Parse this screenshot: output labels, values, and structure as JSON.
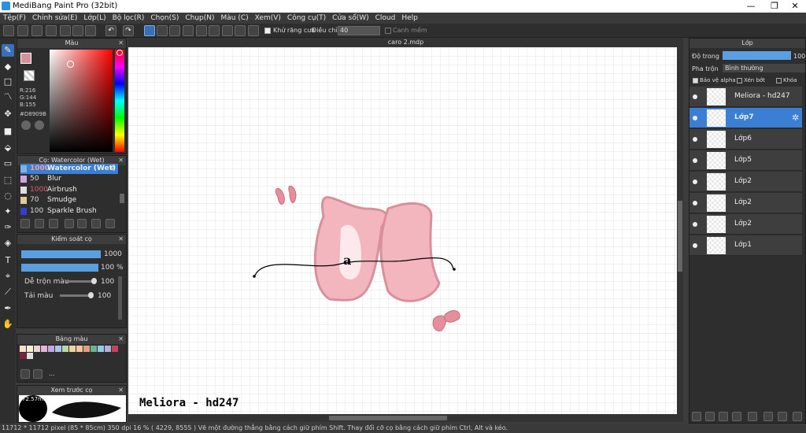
{
  "window": {
    "title": "MediBang Paint Pro (32bit)"
  },
  "menu": [
    "Tệp(F)",
    "Chỉnh sửa(E)",
    "Lớp(L)",
    "Bộ lọc(R)",
    "Chọn(S)",
    "Chụp(N)",
    "Màu (C)",
    "Xem(V)",
    "Công cụ(T)",
    "Cửa sổ(W)",
    "Cloud",
    "Help"
  ],
  "toolbar": {
    "antialias_label": "Khử răng cưa",
    "adjust_label": "Điều chỉnh",
    "adjust_value": "40",
    "smooth_label": "Canh mềm"
  },
  "color_panel": {
    "title": "Màu",
    "r": "R:216",
    "g": "G:144",
    "b": "B:155",
    "hex": "#D8909B",
    "current_color": "#D8909B"
  },
  "brush_panel": {
    "title": "Cọ: Watercolor (Wet)",
    "items": [
      {
        "size": "1000",
        "name": "Watercolor (Wet)",
        "color": "#7fb3e8"
      },
      {
        "size": "50",
        "name": "Blur",
        "color": "#d8a0e0"
      },
      {
        "size": "1000",
        "name": "Airbrush",
        "color": "#e0e0e0"
      },
      {
        "size": "70",
        "name": "Smudge",
        "color": "#e6c89c"
      },
      {
        "size": "100",
        "name": "Sparkle Brush",
        "color": "#3040d0"
      }
    ]
  },
  "brush_control": {
    "title": "Kiểm soát cọ",
    "size_value": "1000",
    "opacity_value": "100 %",
    "mix_label": "Dễ trộn màu",
    "mix_value": "100",
    "load_label": "Tải màu",
    "load_value": "100",
    "size_fill": 1.0,
    "opacity_fill": 1.0
  },
  "palette_panel": {
    "title": "Bảng màu",
    "more": "..."
  },
  "preview_panel": {
    "title": "Xem trước cọ",
    "size": "72.57mm"
  },
  "document": {
    "tab": "caro 2.mdp",
    "canvas_text": "Meliora - hd247"
  },
  "layer_panel": {
    "title": "Lớp",
    "opacity_label": "Độ trong",
    "opacity_value": "100",
    "blend_label": "Pha trộn",
    "blend_value": "Bình thường",
    "protect_alpha": "Bảo vệ alpha",
    "clip": "Xén bớt",
    "lock": "Khóa",
    "layers": [
      "Meliora - hd247",
      "Lớp7",
      "Lớp6",
      "Lớp5",
      "Lớp2",
      "Lớp2",
      "Lớp2",
      "Lớp1"
    ]
  },
  "status": {
    "text": "11712 * 11712 pixel  (85 * 85cm)  350 dpi  16 %  ( 4229, 8555 )  Vẽ một đường thẳng bằng cách giữ phím Shift. Thay đổi cỡ cọ bằng cách giữ phím Ctrl, Alt và kéo."
  }
}
